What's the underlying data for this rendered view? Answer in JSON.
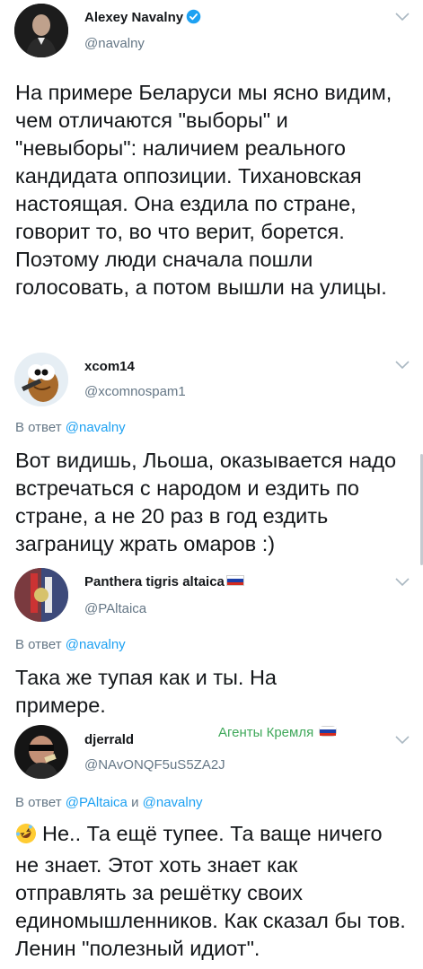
{
  "tweets": [
    {
      "author": "Alexey Navalny",
      "handle": "@navalny",
      "verified": true,
      "text": "На примере Беларуси мы ясно видим, чем отличаются \"выборы\" и \"невыборы\": наличием реального кандидата оппозиции. Тихановская настоящая. Она ездила по стране, говорит то, во что верит, борется. Поэтому люди сначала пошли голосовать, а потом вышли на улицы."
    },
    {
      "author": "xcom14",
      "handle": "@xcomnospam1",
      "reply_prefix": "В ответ",
      "reply_mentions": [
        "@navalny"
      ],
      "text": "Вот видишь, Льоша, оказывается надо встречаться с народом и ездить по стране, а не 20 раз в год ездить заграницу жрать омаров :)"
    },
    {
      "author": "Panthera tigris altaica",
      "handle": "@PAltaica",
      "flag": "russia",
      "reply_prefix": "В ответ",
      "reply_mentions": [
        "@navalny"
      ],
      "text": "Така же тупая как и ты. На примере."
    },
    {
      "author": "djerrald",
      "handle": "@NAvONQF5uS5ZA2J",
      "badge": "Агенты Кремля",
      "reply_prefix": "В ответ",
      "reply_mentions": [
        "@PAltaica",
        "@navalny"
      ],
      "reply_join": "и",
      "text": "Не.. Та ещё тупее. Та ваще ничего не знает. Этот хоть знает как отправлять за решётку своих единомышленников. Как сказал бы тов. Ленин \"полезный идиот\".",
      "emoji": "rolling-on-floor-laughing-emoji"
    }
  ],
  "colors": {
    "link": "#1da1f2",
    "secondary": "#657786",
    "badge": "#3fa85a"
  }
}
